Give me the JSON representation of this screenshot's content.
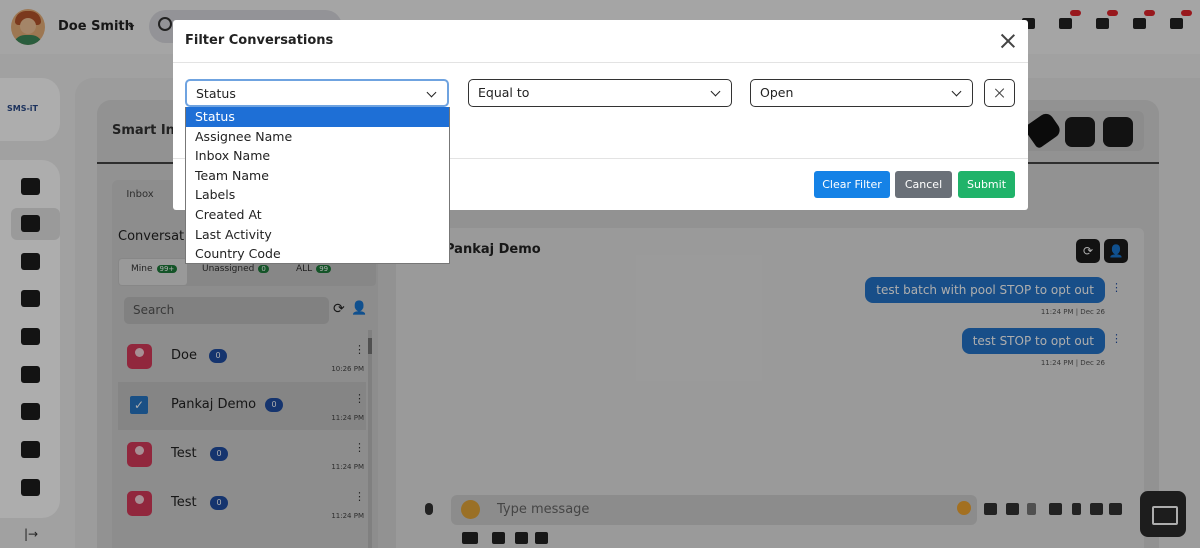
{
  "topbar": {
    "user_name": "Doe Smith",
    "icons": [
      "dialpad-icon",
      "chat-notification-icon",
      "print-notification-icon",
      "megaphone-notification-icon",
      "phone-notification-icon"
    ]
  },
  "brand": {
    "logo_text": "SMS-iT"
  },
  "inbox": {
    "title": "Smart Inbox",
    "chip_label": "Inbox"
  },
  "conversations": {
    "title": "Conversations",
    "tabs": [
      {
        "label": "Mine",
        "count": "99+"
      },
      {
        "label": "Unassigned",
        "count": "0"
      },
      {
        "label": "ALL",
        "count": "99"
      }
    ],
    "search_placeholder": "Search",
    "items": [
      {
        "name": "Doe",
        "count": "0",
        "time": "10:26 PM"
      },
      {
        "name": "Pankaj Demo",
        "count": "0",
        "time": "11:24 PM"
      },
      {
        "name": "Test",
        "count": "0",
        "time": "11:24 PM"
      },
      {
        "name": "Test",
        "count": "0",
        "time": "11:24 PM"
      }
    ]
  },
  "chat": {
    "contact_name": "Pankaj Demo",
    "messages": [
      {
        "text": "test batch with pool STOP to opt out",
        "meta": "11:24 PM | Dec 26"
      },
      {
        "text": "test STOP to opt out",
        "meta": "11:24 PM | Dec 26"
      }
    ],
    "composer_placeholder": "Type message"
  },
  "modal": {
    "title": "Filter Conversations",
    "field_select": {
      "value": "Status"
    },
    "operator_select": {
      "value": "Equal to"
    },
    "value_select": {
      "value": "Open"
    },
    "field_options": [
      "Status",
      "Assignee Name",
      "Inbox Name",
      "Team Name",
      "Labels",
      "Created At",
      "Last Activity",
      "Country Code"
    ],
    "buttons": {
      "clear": "Clear Filter",
      "cancel": "Cancel",
      "submit": "Submit"
    }
  },
  "colors": {
    "primary": "#1582e6",
    "cancel": "#6a7078",
    "submit": "#20b36a",
    "dropdown_selected": "#1e6fd6",
    "bubble": "#2474c9"
  }
}
